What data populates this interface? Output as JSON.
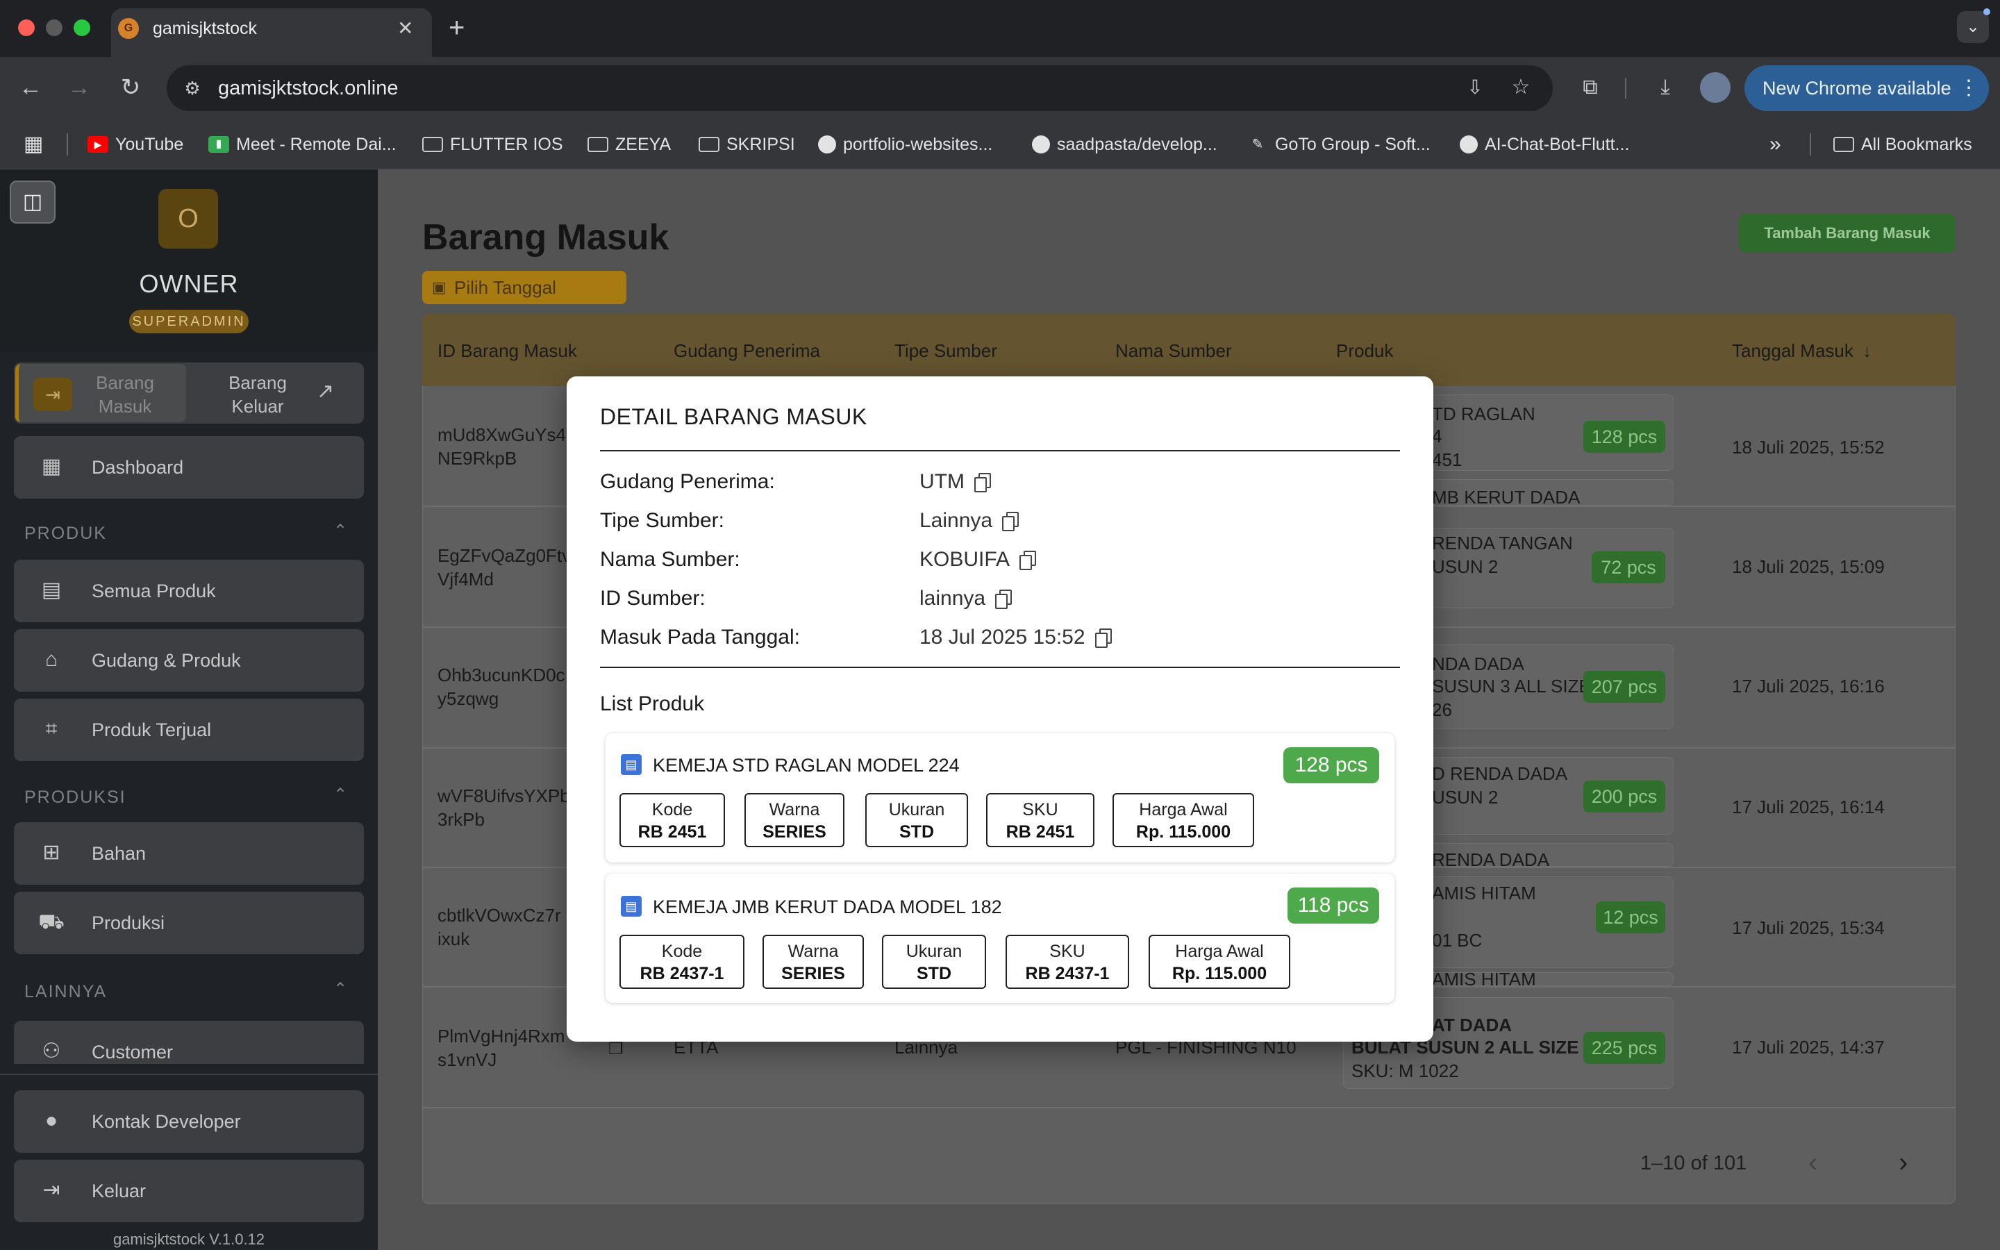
{
  "browser": {
    "tab_title": "gamisjktstock",
    "tab_favicon_letter": "G",
    "url": "gamisjktstock.online",
    "new_chrome_label": "New Chrome available",
    "bookmarks": [
      {
        "label": "YouTube",
        "icon": "youtube-icon",
        "color": "#ff0000"
      },
      {
        "label": "Meet - Remote Dai...",
        "icon": "meet-icon",
        "color": "#34a853"
      },
      {
        "label": "FLUTTER IOS",
        "icon": "folder-icon"
      },
      {
        "label": "ZEEYA",
        "icon": "folder-icon"
      },
      {
        "label": "SKRIPSI",
        "icon": "folder-icon"
      },
      {
        "label": "portfolio-websites...",
        "icon": "github-icon"
      },
      {
        "label": "saadpasta/develop...",
        "icon": "github-icon"
      },
      {
        "label": "GoTo Group - Soft...",
        "icon": "pen-icon"
      },
      {
        "label": "AI-Chat-Bot-Flutt...",
        "icon": "github-icon"
      }
    ],
    "overflow_label": "»",
    "all_bookmarks_label": "All Bookmarks"
  },
  "sidebar": {
    "avatar_letter": "O",
    "user_name": "OWNER",
    "user_role": "SUPERADMIN",
    "toggle_barang_masuk": "Barang Masuk",
    "toggle_barang_keluar": "Barang Keluar",
    "dashboard": "Dashboard",
    "section_produk": "PRODUK",
    "semua_produk": "Semua Produk",
    "gudang_produk": "Gudang & Produk",
    "produk_terjual": "Produk Terjual",
    "section_produksi": "PRODUKSI",
    "bahan": "Bahan",
    "produksi": "Produksi",
    "section_lainnya": "LAINNYA",
    "customer": "Customer",
    "kontak_developer": "Kontak Developer",
    "keluar": "Keluar",
    "version": "gamisjktstock V.1.0.12"
  },
  "main": {
    "title": "Barang Masuk",
    "pick_date": "Pilih Tanggal",
    "add_button": "Tambah Barang Masuk",
    "columns": [
      "ID Barang Masuk",
      "Gudang Penerima",
      "Tipe Sumber",
      "Nama Sumber",
      "Produk",
      "Tanggal Masuk"
    ],
    "sort_arrow": "↓",
    "rows": [
      {
        "id_1": "mUd8XwGuYs4",
        "id_2": "NE9RkpB",
        "prod_a": "TD RAGLAN",
        "prod_b": "4",
        "prod_c": "451",
        "prod_next": "MB KERUT DADA",
        "pcs": "128 pcs",
        "date": "18 Juli 2025, 15:52"
      },
      {
        "id_1": "EgZFvQaZg0Ftv",
        "id_2": "Vjf4Md",
        "prod_a": "RENDA TANGAN",
        "prod_b": "USUN 2",
        "prod_c": "",
        "prod_next": "",
        "pcs": "72 pcs",
        "date": "18 Juli 2025, 15:09"
      },
      {
        "id_1": "Ohb3ucunKD0c",
        "id_2": "y5zqwg",
        "prod_a": "NDA DADA",
        "prod_b": "SUSUN 3 ALL SIZE",
        "prod_c": "26",
        "prod_next": "",
        "pcs": "207 pcs",
        "date": "17 Juli 2025, 16:16"
      },
      {
        "id_1": "wVF8UifvsYXPb",
        "id_2": "3rkPb",
        "prod_a": "D RENDA DADA",
        "prod_b": "USUN 2",
        "prod_c": "",
        "prod_next": "RENDA DADA",
        "pcs": "200 pcs",
        "date": "17 Juli 2025, 16:14"
      },
      {
        "id_1": "cbtlkVOwxCz7r",
        "id_2": "ixuk",
        "prod_a": "AMIS HITAM",
        "prod_b": "",
        "prod_c": "01 BC",
        "prod_next": "AMIS HITAM",
        "pcs": "12 pcs",
        "date": "17 Juli 2025, 15:34"
      },
      {
        "id_1": "PlmVgHnj4Rxm",
        "id_2": "s1vnVJ",
        "gudang": "ETTA",
        "tipe": "Lainnya",
        "nama": "PGL - FINISHING N10",
        "prod_a": "AT DADA",
        "prod_b": "BULAT SUSUN 2 ALL SIZE",
        "prod_c": "SKU: M 1022",
        "prod_next": "",
        "pcs": "225 pcs",
        "date": "17 Juli 2025, 14:37"
      }
    ],
    "pager": "1–10 of 101"
  },
  "modal": {
    "title": "DETAIL BARANG MASUK",
    "details": [
      {
        "label": "Gudang Penerima:",
        "value": "UTM"
      },
      {
        "label": "Tipe Sumber:",
        "value": "Lainnya"
      },
      {
        "label": "Nama Sumber:",
        "value": "KOBUIFA"
      },
      {
        "label": "ID Sumber:",
        "value": "lainnya"
      },
      {
        "label": "Masuk Pada Tanggal:",
        "value": "18 Jul 2025 15:52"
      }
    ],
    "list_label": "List Produk",
    "items": [
      {
        "name": "KEMEJA STD RAGLAN MODEL 224",
        "pcs": "128 pcs",
        "chips": [
          {
            "k": "Kode",
            "v": "RB 2451"
          },
          {
            "k": "Warna",
            "v": "SERIES"
          },
          {
            "k": "Ukuran",
            "v": "STD"
          },
          {
            "k": "SKU",
            "v": "RB 2451"
          },
          {
            "k": "Harga Awal",
            "v": "Rp. 115.000"
          }
        ]
      },
      {
        "name": "KEMEJA JMB KERUT DADA MODEL 182",
        "pcs": "118 pcs",
        "chips": [
          {
            "k": "Kode",
            "v": "RB 2437-1"
          },
          {
            "k": "Warna",
            "v": "SERIES"
          },
          {
            "k": "Ukuran",
            "v": "STD"
          },
          {
            "k": "SKU",
            "v": "RB 2437-1"
          },
          {
            "k": "Harga Awal",
            "v": "Rp. 115.000"
          }
        ]
      }
    ]
  },
  "colors": {
    "accent": "#a87a12",
    "success": "#4ea94a",
    "chrome_blue": "#2c5f95"
  }
}
